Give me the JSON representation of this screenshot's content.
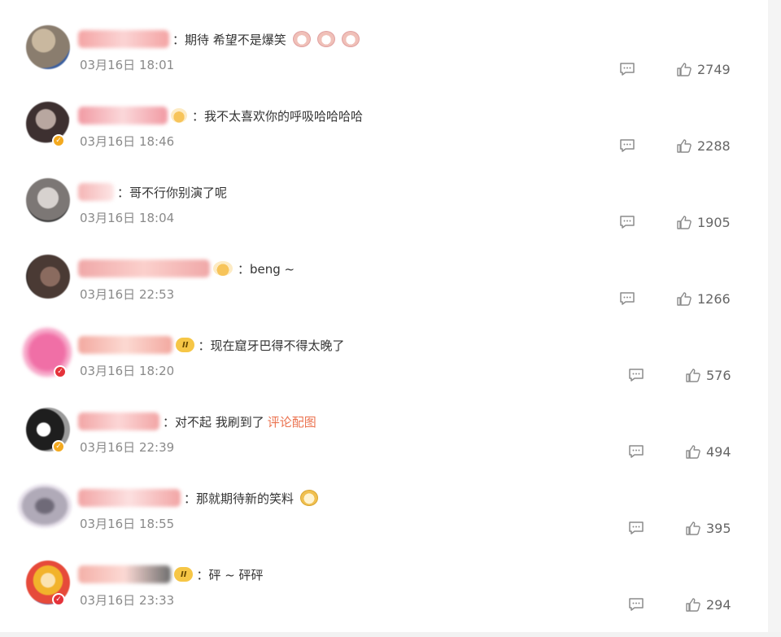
{
  "comments": [
    {
      "text": "：期待 希望不是爆笑",
      "emojis": [
        "doge-cheer",
        "doge-cheer",
        "doge-cheer"
      ],
      "time": "03月16日 18:01",
      "likes": "2749",
      "avatar_colors": [
        "#8a7d6e",
        "#c9b89f",
        "#3b5fa0"
      ],
      "username_colors": [
        "#f4a4a4",
        "#fbd4d4"
      ]
    },
    {
      "text": "：我不太喜欢你的呼吸哈哈哈哈",
      "time": "03月16日 18:46",
      "likes": "2288",
      "avatar_colors": [
        "#3d3030",
        "#b8a7a0",
        "#ffffff"
      ],
      "username_colors": [
        "#f19aa3",
        "#fbd8da"
      ]
    },
    {
      "text": "：哥不行你别演了呢",
      "time": "03月16日 18:04",
      "likes": "1905",
      "avatar_colors": [
        "#7c7775",
        "#d7d2cf",
        "#3c3c3c"
      ],
      "username_colors": [
        "#f5b5b5",
        "#fde6e6"
      ]
    },
    {
      "text": "：beng ~",
      "time": "03月16日 22:53",
      "likes": "1266",
      "avatar_colors": [
        "#4a3a34",
        "#8a6b5f",
        "#2d2624"
      ],
      "username_colors": [
        "#f0a8a8",
        "#fbd0cc"
      ]
    },
    {
      "text": "：现在窟牙巴得不得太晚了",
      "time": "03月16日 18:20",
      "likes": "576",
      "badge": "II",
      "avatar_colors": [
        "#f06fa6",
        "#f7a8c9",
        "#fbd0e0"
      ],
      "username_colors": [
        "#f3a9a0",
        "#fcd9d2"
      ]
    },
    {
      "text": "：对不起 我刷到了",
      "link": "评论配图",
      "time": "03月16日 22:39",
      "likes": "494",
      "avatar_colors": [
        "#1e1e1e",
        "#9a9a9a",
        "#ffffff"
      ],
      "username_colors": [
        "#f2a5a5",
        "#fcd6d6"
      ]
    },
    {
      "text": "：那就期待新的笑料",
      "emojis": [
        "doge"
      ],
      "time": "03月16日 18:55",
      "likes": "395",
      "avatar_colors": [
        "#b0aab8",
        "#e6e0ea",
        "#6f6a78"
      ],
      "username_colors": [
        "#f2a5a5",
        "#fce0e0"
      ]
    },
    {
      "text": "：砰 ~ 砰砰",
      "time": "03月16日 23:33",
      "likes": "294",
      "badge": "II",
      "avatar_colors": [
        "#f2b32b",
        "#e64a3a",
        "#2c4fb0"
      ],
      "username_colors": [
        "#f4b0a8",
        "#6e6e6e"
      ]
    }
  ]
}
